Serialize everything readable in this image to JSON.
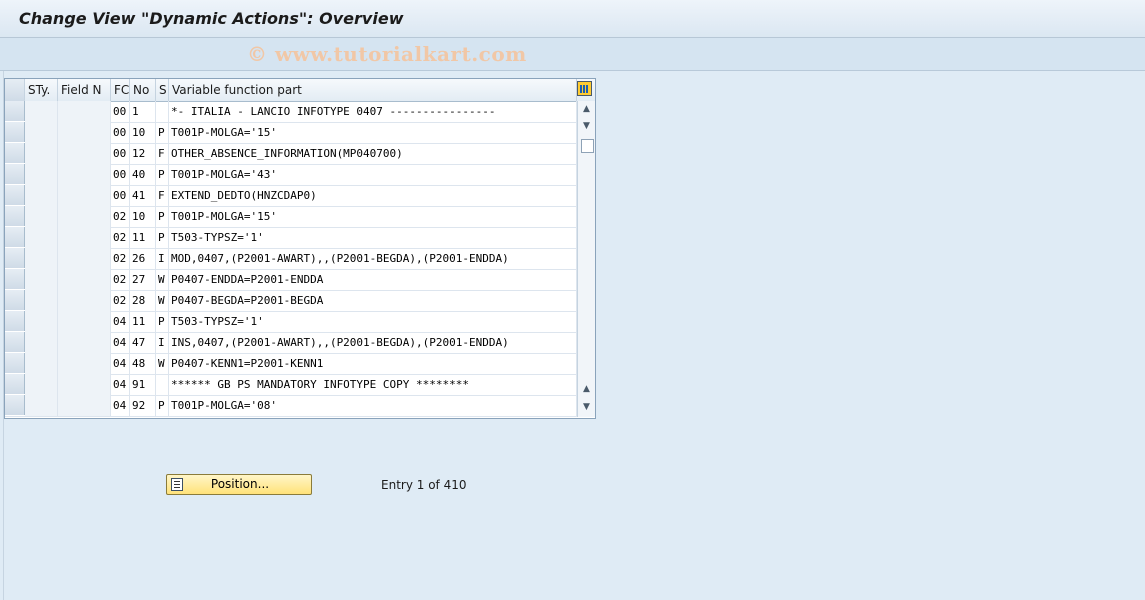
{
  "window": {
    "title": "Change View \"Dynamic Actions\": Overview",
    "watermark": "© www.tutorialkart.com"
  },
  "table": {
    "columns": [
      "STy.",
      "Field N",
      "FC",
      "No",
      "S",
      "Variable function part"
    ],
    "rows": [
      {
        "sty": "",
        "field": "",
        "fc": "00",
        "no": "1",
        "s": "",
        "func": "*- ITALIA - LANCIO INFOTYPE 0407 ----------------"
      },
      {
        "sty": "",
        "field": "",
        "fc": "00",
        "no": "10",
        "s": "P",
        "func": "T001P-MOLGA='15'"
      },
      {
        "sty": "",
        "field": "",
        "fc": "00",
        "no": "12",
        "s": "F",
        "func": "OTHER_ABSENCE_INFORMATION(MP040700)"
      },
      {
        "sty": "",
        "field": "",
        "fc": "00",
        "no": "40",
        "s": "P",
        "func": "T001P-MOLGA='43'"
      },
      {
        "sty": "",
        "field": "",
        "fc": "00",
        "no": "41",
        "s": "F",
        "func": "EXTEND_DEDTO(HNZCDAP0)"
      },
      {
        "sty": "",
        "field": "",
        "fc": "02",
        "no": "10",
        "s": "P",
        "func": "T001P-MOLGA='15'"
      },
      {
        "sty": "",
        "field": "",
        "fc": "02",
        "no": "11",
        "s": "P",
        "func": "T503-TYPSZ='1'"
      },
      {
        "sty": "",
        "field": "",
        "fc": "02",
        "no": "26",
        "s": "I",
        "func": "MOD,0407,(P2001-AWART),,(P2001-BEGDA),(P2001-ENDDA)"
      },
      {
        "sty": "",
        "field": "",
        "fc": "02",
        "no": "27",
        "s": "W",
        "func": "P0407-ENDDA=P2001-ENDDA"
      },
      {
        "sty": "",
        "field": "",
        "fc": "02",
        "no": "28",
        "s": "W",
        "func": "P0407-BEGDA=P2001-BEGDA"
      },
      {
        "sty": "",
        "field": "",
        "fc": "04",
        "no": "11",
        "s": "P",
        "func": "T503-TYPSZ='1'"
      },
      {
        "sty": "",
        "field": "",
        "fc": "04",
        "no": "47",
        "s": "I",
        "func": "INS,0407,(P2001-AWART),,(P2001-BEGDA),(P2001-ENDDA)"
      },
      {
        "sty": "",
        "field": "",
        "fc": "04",
        "no": "48",
        "s": "W",
        "func": "P0407-KENN1=P2001-KENN1"
      },
      {
        "sty": "",
        "field": "",
        "fc": "04",
        "no": "91",
        "s": "",
        "func": "****** GB PS MANDATORY INFOTYPE COPY ********"
      },
      {
        "sty": "",
        "field": "",
        "fc": "04",
        "no": "92",
        "s": "P",
        "func": "T001P-MOLGA='08'"
      }
    ]
  },
  "footer": {
    "position_button": "Position...",
    "entry_text": "Entry 1 of 410"
  },
  "icons": {
    "config": "table-settings-icon",
    "position": "position-icon",
    "scroll_up": "▲",
    "scroll_down": "▼"
  }
}
